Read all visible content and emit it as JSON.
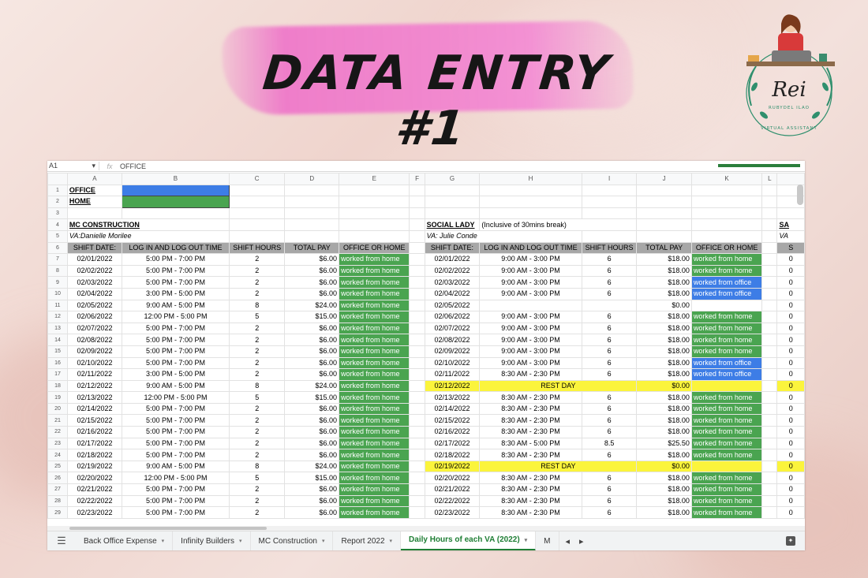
{
  "header": {
    "title": "DATA ENTRY #1",
    "logo_text": "Rei",
    "logo_name": "RUBYDEL ILAO",
    "logo_subtitle": "VIRTUAL ASSISTANT"
  },
  "colors": {
    "green": "#4aa450",
    "blue": "#3d7de6",
    "yellow": "#fbf43c",
    "brush": "#f07bd2",
    "header_gray": "#a7a7a7"
  },
  "formula_bar": {
    "cell_ref": "A1",
    "fx_label": "fx",
    "content": "OFFICE"
  },
  "columns": [
    "A",
    "B",
    "C",
    "D",
    "E",
    "F",
    "G",
    "H",
    "I",
    "J",
    "K",
    "L"
  ],
  "legend": {
    "office": "OFFICE",
    "home": "HOME"
  },
  "left": {
    "name": "MC CONSTRUCTION",
    "va": "VA:Danielle Morilee",
    "headers": [
      "SHIFT DATE:",
      "LOG IN AND LOG OUT TIME",
      "SHIFT HOURS",
      "TOTAL PAY",
      "OFFICE OR HOME"
    ],
    "rows": [
      [
        "02/01/2022",
        "5:00 PM - 7:00 PM",
        "2",
        "$6.00",
        "worked from home"
      ],
      [
        "02/02/2022",
        "5:00 PM - 7:00 PM",
        "2",
        "$6.00",
        "worked from home"
      ],
      [
        "02/03/2022",
        "5:00 PM - 7:00 PM",
        "2",
        "$6.00",
        "worked from home"
      ],
      [
        "02/04/2022",
        "3:00 PM - 5:00 PM",
        "2",
        "$6.00",
        "worked from home"
      ],
      [
        "02/05/2022",
        "9:00 AM - 5:00 PM",
        "8",
        "$24.00",
        "worked from home"
      ],
      [
        "02/06/2022",
        "12:00 PM - 5:00 PM",
        "5",
        "$15.00",
        "worked from home"
      ],
      [
        "02/07/2022",
        "5:00 PM - 7:00 PM",
        "2",
        "$6.00",
        "worked from home"
      ],
      [
        "02/08/2022",
        "5:00 PM - 7:00 PM",
        "2",
        "$6.00",
        "worked from home"
      ],
      [
        "02/09/2022",
        "5:00 PM - 7:00 PM",
        "2",
        "$6.00",
        "worked from home"
      ],
      [
        "02/10/2022",
        "5:00 PM - 7:00 PM",
        "2",
        "$6.00",
        "worked from home"
      ],
      [
        "02/11/2022",
        "3:00 PM - 5:00 PM",
        "2",
        "$6.00",
        "worked from home"
      ],
      [
        "02/12/2022",
        "9:00 AM - 5:00 PM",
        "8",
        "$24.00",
        "worked from home"
      ],
      [
        "02/13/2022",
        "12:00 PM - 5:00 PM",
        "5",
        "$15.00",
        "worked from home"
      ],
      [
        "02/14/2022",
        "5:00 PM - 7:00 PM",
        "2",
        "$6.00",
        "worked from home"
      ],
      [
        "02/15/2022",
        "5:00 PM - 7:00 PM",
        "2",
        "$6.00",
        "worked from home"
      ],
      [
        "02/16/2022",
        "5:00 PM - 7:00 PM",
        "2",
        "$6.00",
        "worked from home"
      ],
      [
        "02/17/2022",
        "5:00 PM - 7:00 PM",
        "2",
        "$6.00",
        "worked from home"
      ],
      [
        "02/18/2022",
        "5:00 PM - 7:00 PM",
        "2",
        "$6.00",
        "worked from home"
      ],
      [
        "02/19/2022",
        "9:00 AM - 5:00 PM",
        "8",
        "$24.00",
        "worked from home"
      ],
      [
        "02/20/2022",
        "12:00 PM - 5:00 PM",
        "5",
        "$15.00",
        "worked from home"
      ],
      [
        "02/21/2022",
        "5:00 PM - 7:00 PM",
        "2",
        "$6.00",
        "worked from home"
      ],
      [
        "02/22/2022",
        "5:00 PM - 7:00 PM",
        "2",
        "$6.00",
        "worked from home"
      ],
      [
        "02/23/2022",
        "5:00 PM - 7:00 PM",
        "2",
        "$6.00",
        "worked from home"
      ]
    ]
  },
  "right": {
    "name": "SOCIAL LADY",
    "note": "(Inclusive of 30mins break)",
    "va": "VA: Julie Conde",
    "headers": [
      "SHIFT DATE:",
      "LOG IN AND LOG OUT TIME",
      "SHIFT HOURS",
      "TOTAL PAY",
      "OFFICE OR HOME"
    ],
    "rows": [
      {
        "date": "02/01/2022",
        "time": "9:00 AM - 3:00 PM",
        "hours": "6",
        "pay": "$18.00",
        "where": "worked from home",
        "style": "home"
      },
      {
        "date": "02/02/2022",
        "time": "9:00 AM - 3:00 PM",
        "hours": "6",
        "pay": "$18.00",
        "where": "worked from home",
        "style": "home"
      },
      {
        "date": "02/03/2022",
        "time": "9:00 AM - 3:00 PM",
        "hours": "6",
        "pay": "$18.00",
        "where": "worked from office",
        "style": "office"
      },
      {
        "date": "02/04/2022",
        "time": "9:00 AM - 3:00 PM",
        "hours": "6",
        "pay": "$18.00",
        "where": "worked from office",
        "style": "office"
      },
      {
        "date": "02/05/2022",
        "time": "",
        "hours": "",
        "pay": "$0.00",
        "where": "",
        "style": "blank"
      },
      {
        "date": "02/06/2022",
        "time": "9:00 AM - 3:00 PM",
        "hours": "6",
        "pay": "$18.00",
        "where": "worked from home",
        "style": "home"
      },
      {
        "date": "02/07/2022",
        "time": "9:00 AM - 3:00 PM",
        "hours": "6",
        "pay": "$18.00",
        "where": "worked from home",
        "style": "home"
      },
      {
        "date": "02/08/2022",
        "time": "9:00 AM - 3:00 PM",
        "hours": "6",
        "pay": "$18.00",
        "where": "worked from home",
        "style": "home"
      },
      {
        "date": "02/09/2022",
        "time": "9:00 AM - 3:00 PM",
        "hours": "6",
        "pay": "$18.00",
        "where": "worked from home",
        "style": "home"
      },
      {
        "date": "02/10/2022",
        "time": "9:00 AM - 3:00 PM",
        "hours": "6",
        "pay": "$18.00",
        "where": "worked from office",
        "style": "office"
      },
      {
        "date": "02/11/2022",
        "time": "8:30 AM - 2:30 PM",
        "hours": "6",
        "pay": "$18.00",
        "where": "worked from office",
        "style": "office"
      },
      {
        "date": "02/12/2022",
        "time": "REST DAY",
        "hours": "",
        "pay": "$0.00",
        "where": "",
        "style": "rest"
      },
      {
        "date": "02/13/2022",
        "time": "8:30 AM - 2:30 PM",
        "hours": "6",
        "pay": "$18.00",
        "where": "worked from home",
        "style": "home"
      },
      {
        "date": "02/14/2022",
        "time": "8:30 AM - 2:30 PM",
        "hours": "6",
        "pay": "$18.00",
        "where": "worked from home",
        "style": "home"
      },
      {
        "date": "02/15/2022",
        "time": "8:30 AM - 2:30 PM",
        "hours": "6",
        "pay": "$18.00",
        "where": "worked from home",
        "style": "home"
      },
      {
        "date": "02/16/2022",
        "time": "8:30 AM - 2:30 PM",
        "hours": "6",
        "pay": "$18.00",
        "where": "worked from home",
        "style": "home"
      },
      {
        "date": "02/17/2022",
        "time": "8:30 AM - 5:00 PM",
        "hours": "8.5",
        "pay": "$25.50",
        "where": "worked from home",
        "style": "home"
      },
      {
        "date": "02/18/2022",
        "time": "8:30 AM - 2:30 PM",
        "hours": "6",
        "pay": "$18.00",
        "where": "worked from home",
        "style": "home"
      },
      {
        "date": "02/19/2022",
        "time": "REST DAY",
        "hours": "",
        "pay": "$0.00",
        "where": "",
        "style": "rest"
      },
      {
        "date": "02/20/2022",
        "time": "8:30 AM - 2:30 PM",
        "hours": "6",
        "pay": "$18.00",
        "where": "worked from home",
        "style": "home"
      },
      {
        "date": "02/21/2022",
        "time": "8:30 AM - 2:30 PM",
        "hours": "6",
        "pay": "$18.00",
        "where": "worked from home",
        "style": "home"
      },
      {
        "date": "02/22/2022",
        "time": "8:30 AM - 2:30 PM",
        "hours": "6",
        "pay": "$18.00",
        "where": "worked from home",
        "style": "home"
      },
      {
        "date": "02/23/2022",
        "time": "8:30 AM - 2:30 PM",
        "hours": "6",
        "pay": "$18.00",
        "where": "worked from home",
        "style": "home"
      }
    ]
  },
  "partial": {
    "name": "SA",
    "va": "VA",
    "header": "S",
    "cell": "0"
  },
  "tabs": [
    {
      "label": "Back Office Expense",
      "active": false
    },
    {
      "label": "Infinity Builders",
      "active": false
    },
    {
      "label": "MC Construction",
      "active": false
    },
    {
      "label": "Report 2022",
      "active": false
    },
    {
      "label": "Daily Hours of each VA (2022)",
      "active": true
    },
    {
      "label": "M",
      "active": false
    }
  ]
}
